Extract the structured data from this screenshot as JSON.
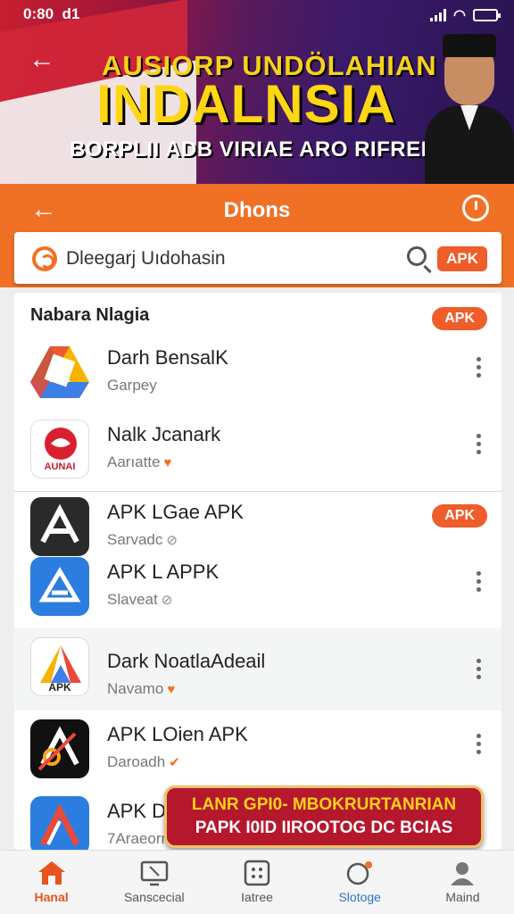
{
  "status_bar": {
    "time": "0:80",
    "extra": "d1"
  },
  "banner": {
    "line1": "AUSIORP UNDÖLAHIAN",
    "line2": "INDALNSIA",
    "line3": "BORPLII ADB VIRIAE ARO RIFRENIUE!"
  },
  "app_bar": {
    "title": "Dhons"
  },
  "search": {
    "value": "Dleegarj Uıdohasin",
    "apk_label": "APK"
  },
  "list": {
    "header": "Nabara Nlagia",
    "header_badge": "APK",
    "items": [
      {
        "name": "Darh BensalK",
        "sub": "Garpey",
        "badge": "",
        "trailing": "more"
      },
      {
        "name": "Nalk Jcanark",
        "sub": "Aarıatte",
        "badge": "heart",
        "trailing": "more"
      },
      {
        "name": "APK LGae APK",
        "sub": "Sarvadc",
        "badge": "check",
        "trailing": "APK"
      },
      {
        "name": "APK L APPK",
        "sub": "Slaveat",
        "badge": "check",
        "trailing": "more"
      },
      {
        "name": "Dark NoatlaAdeail",
        "sub": "Navamo",
        "badge": "heart",
        "trailing": "more"
      },
      {
        "name": "APK LOien APK",
        "sub": "Daroadh",
        "badge": "check-orange",
        "trailing": "more"
      },
      {
        "name": "APK D",
        "sub": "7Araeorn",
        "badge": "",
        "trailing": ""
      }
    ],
    "row2_icon_text": "AUNAI",
    "row5_icon_text": "APK"
  },
  "promo": {
    "line1": "LANR GPI0- MBOKRURTANRIAN",
    "line2": "PAPK I0ID  IIROOTOG DC BCIAS"
  },
  "bottom_nav": [
    {
      "label": "Hanal",
      "icon": "home-icon"
    },
    {
      "label": "Sanscecial",
      "icon": "screen-icon"
    },
    {
      "label": "Iatree",
      "icon": "grid-icon"
    },
    {
      "label": "Slotoge",
      "icon": "planet-icon"
    },
    {
      "label": "Maind",
      "icon": "profile-icon"
    }
  ],
  "colors": {
    "accent": "#f07126",
    "badge": "#ee5d2a",
    "promo": "#b5172d"
  }
}
